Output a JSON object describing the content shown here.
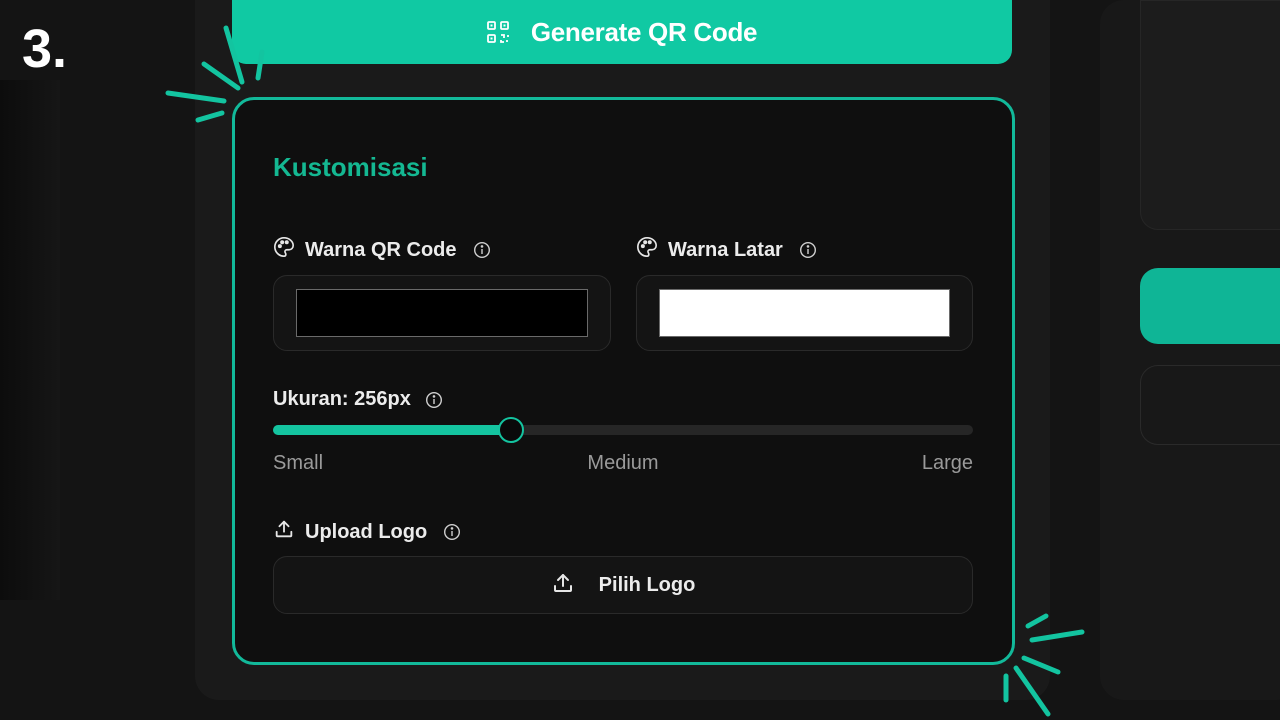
{
  "step": "3.",
  "generate_button": {
    "label": "Generate QR Code",
    "icon": "qr-code-icon"
  },
  "customization": {
    "title": "Kustomisasi",
    "qr_color": {
      "label": "Warna QR Code",
      "value": "#000000",
      "icon": "palette-icon"
    },
    "bg_color": {
      "label": "Warna Latar",
      "value": "#ffffff",
      "icon": "palette-icon"
    },
    "size": {
      "label": "Ukuran: 256px",
      "value": 256,
      "fill_fraction": 0.34,
      "ticks": [
        "Small",
        "Medium",
        "Large"
      ]
    },
    "logo": {
      "label": "Upload Logo",
      "button_label": "Pilih Logo",
      "icon": "upload-icon"
    }
  },
  "colors": {
    "accent": "#12b99a",
    "background": "#0f0f0f"
  }
}
